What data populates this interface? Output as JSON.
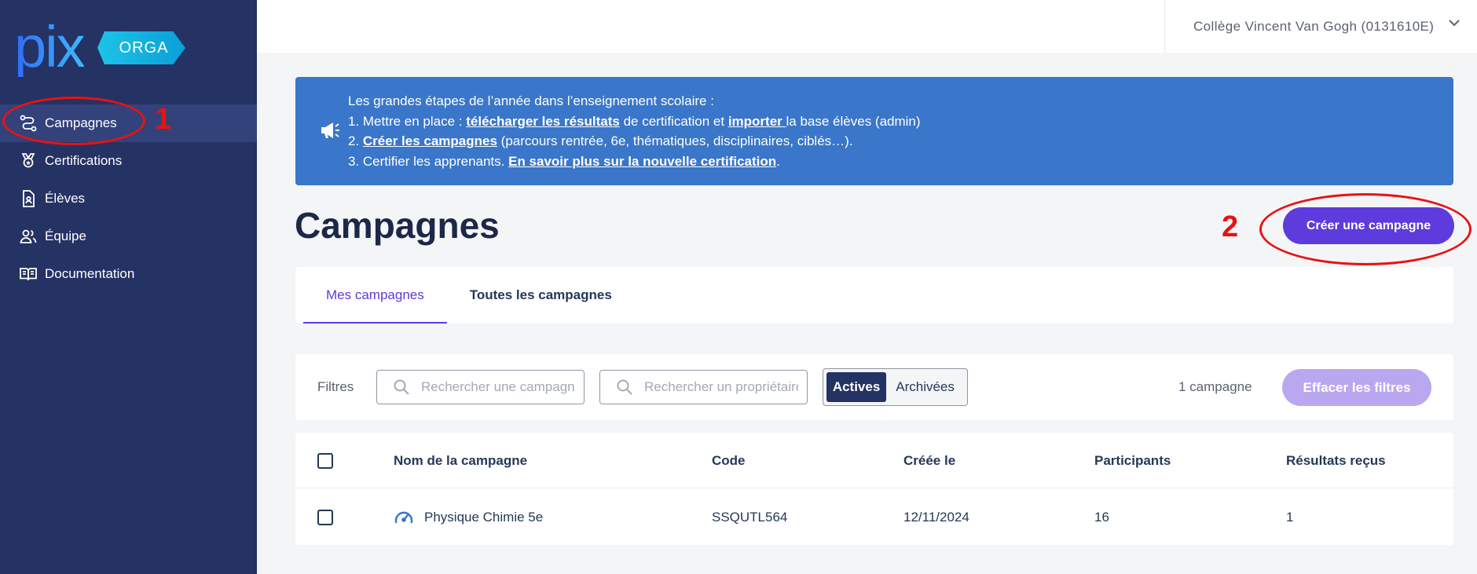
{
  "app": {
    "logo_text": "pix",
    "logo_badge": "ORGA"
  },
  "sidebar": {
    "items": [
      {
        "label": "Campagnes",
        "icon": "route-icon",
        "active": true
      },
      {
        "label": "Certifications",
        "icon": "medal-icon",
        "active": false
      },
      {
        "label": "Élèves",
        "icon": "student-badge-icon",
        "active": false
      },
      {
        "label": "Équipe",
        "icon": "team-icon",
        "active": false
      },
      {
        "label": "Documentation",
        "icon": "book-icon",
        "active": false
      }
    ]
  },
  "header": {
    "organization": "Collège Vincent Van Gogh (0131610E)"
  },
  "banner": {
    "intro": "Les grandes étapes de l’année dans l’enseignement scolaire :",
    "line1_a": "1. Mettre en place : ",
    "line1_link1": "télécharger les résultats",
    "line1_b": " de certification et ",
    "line1_link2": "importer ",
    "line1_c": "la base élèves (admin)",
    "line2_a": "2. ",
    "line2_link": "Créer les campagnes",
    "line2_b": " (parcours rentrée, 6e, thématiques, disciplinaires, ciblés…).",
    "line3_a": "3. Certifier les apprenants. ",
    "line3_link": "En savoir plus sur la nouvelle certification",
    "line3_b": "."
  },
  "page": {
    "title": "Campagnes",
    "create_button": "Créer une campagne"
  },
  "annotations": {
    "marker1": "1",
    "marker2": "2",
    "color": "#e81212"
  },
  "tabs": [
    {
      "label": "Mes campagnes",
      "active": true
    },
    {
      "label": "Toutes les campagnes",
      "active": false
    }
  ],
  "filters": {
    "label": "Filtres",
    "campaign_search_placeholder": "Rechercher une campagne",
    "owner_search_placeholder": "Rechercher un propriétaire",
    "status_active": "Actives",
    "status_archived": "Archivées",
    "count": "1 campagne",
    "clear_button": "Effacer les filtres"
  },
  "table": {
    "columns": [
      "Nom de la campagne",
      "Code",
      "Créée le",
      "Participants",
      "Résultats reçus"
    ],
    "rows": [
      {
        "name": "Physique Chimie 5e",
        "icon": "gauge-icon",
        "code": "SSQUTL564",
        "created": "12/11/2024",
        "participants": "16",
        "results": "1"
      }
    ]
  },
  "colors": {
    "sidebar": "#253264",
    "primary": "#5e3bdc",
    "banner": "#3a76c9"
  }
}
